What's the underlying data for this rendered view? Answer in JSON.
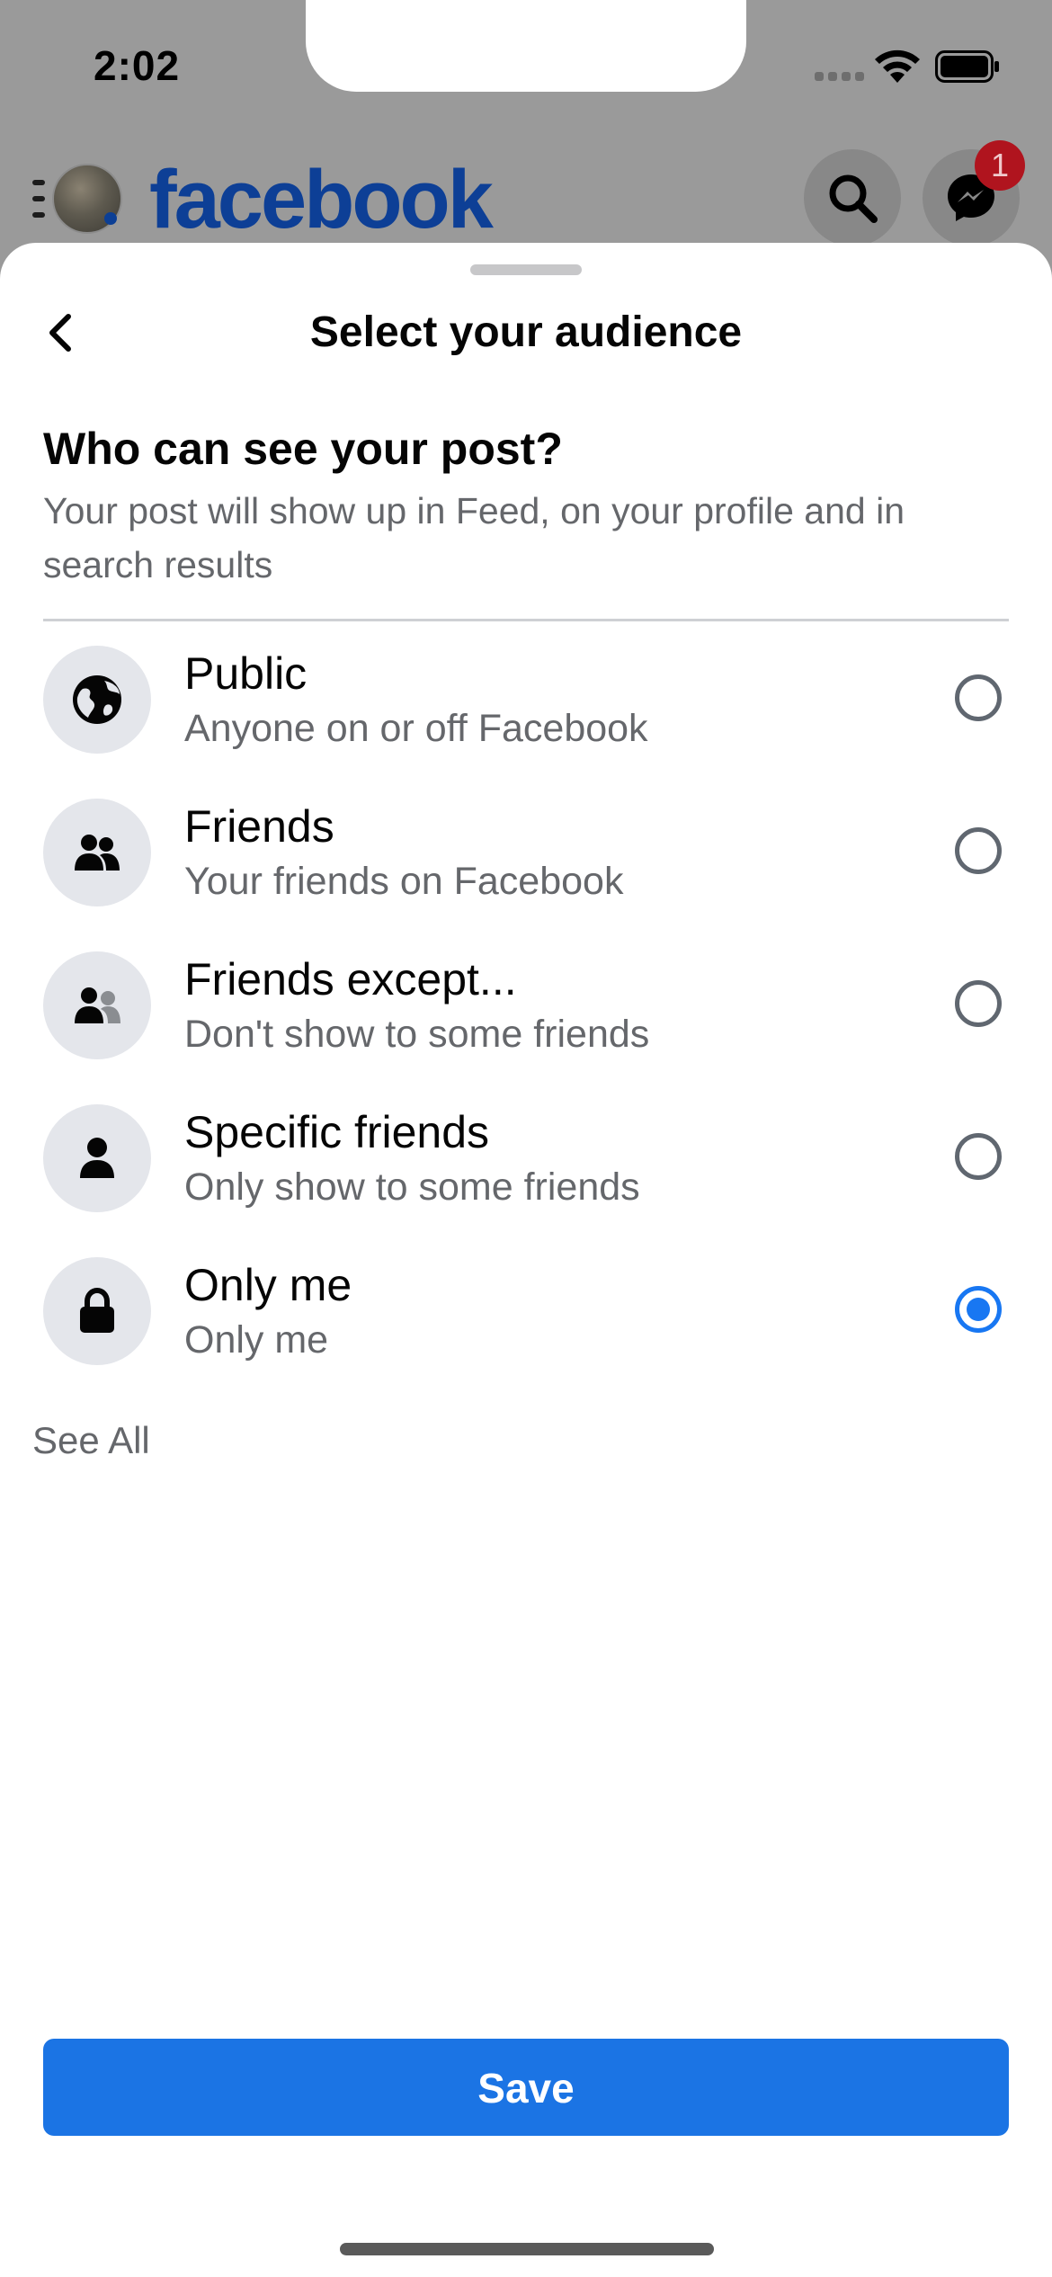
{
  "status_bar": {
    "time": "2:02"
  },
  "app_header": {
    "brand": "facebook",
    "messenger_badge": "1",
    "icons": [
      "menu-icon",
      "avatar",
      "search-icon",
      "messenger-icon"
    ]
  },
  "sheet": {
    "title": "Select your audience",
    "question": "Who can see your post?",
    "question_sub": "Your post will show up in Feed, on your profile and in search results",
    "options": [
      {
        "icon": "globe-icon",
        "title": "Public",
        "subtitle": "Anyone on or off Facebook",
        "selected": false
      },
      {
        "icon": "friends-icon",
        "title": "Friends",
        "subtitle": "Your friends on Facebook",
        "selected": false
      },
      {
        "icon": "friends-except-icon",
        "title": "Friends except...",
        "subtitle": "Don't show to some friends",
        "selected": false
      },
      {
        "icon": "person-icon",
        "title": "Specific friends",
        "subtitle": "Only show to some friends",
        "selected": false
      },
      {
        "icon": "lock-icon",
        "title": "Only me",
        "subtitle": "Only me",
        "selected": true
      }
    ],
    "see_all": "See All",
    "save_label": "Save"
  },
  "colors": {
    "brand_blue": "#1b74e4",
    "radio_selected": "#1877f2",
    "secondary_text": "#65676b",
    "badge_red": "#b0141e"
  }
}
